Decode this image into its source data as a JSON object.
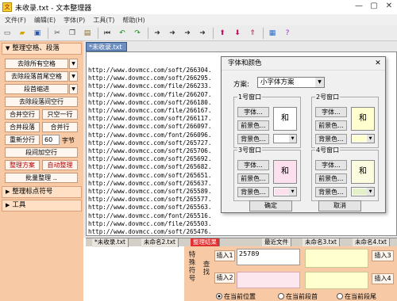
{
  "window": {
    "title": "未收录.txt - 文本整理器",
    "minimize": "—",
    "maximize": "▢",
    "close": "✕"
  },
  "menu": [
    "文件(F)",
    "编辑(E)",
    "字体(P)",
    "工具(T)",
    "帮助(H)"
  ],
  "toolbar_icons": [
    {
      "name": "new-file-icon",
      "glyph": "▭",
      "color": "#555"
    },
    {
      "name": "open-folder-icon",
      "glyph": "▰",
      "color": "#d8a400"
    },
    {
      "name": "save-icon",
      "glyph": "▣",
      "color": "#2a55a8"
    },
    {
      "name": "cut-icon",
      "glyph": "✂",
      "color": "#444"
    },
    {
      "name": "copy-icon",
      "glyph": "❐",
      "color": "#444"
    },
    {
      "name": "paste-icon",
      "glyph": "▤",
      "color": "#8a6a20"
    },
    {
      "name": "first-icon",
      "glyph": "⏮",
      "color": "#333"
    },
    {
      "name": "undo-icon",
      "glyph": "↶",
      "color": "#1a8a1a"
    },
    {
      "name": "redo-icon",
      "glyph": "↷",
      "color": "#1a8a1a"
    },
    {
      "name": "arrow-right-icon",
      "glyph": "➜",
      "color": "#333"
    },
    {
      "name": "arrow-right-2-icon",
      "glyph": "➜",
      "color": "#333"
    },
    {
      "name": "arrow-right-3-icon",
      "glyph": "➜",
      "color": "#333"
    },
    {
      "name": "arrow-right-4-icon",
      "glyph": "➜",
      "color": "#333"
    },
    {
      "name": "move-up-icon",
      "glyph": "⬆",
      "color": "#c01060"
    },
    {
      "name": "move-down-icon",
      "glyph": "⬇",
      "color": "#c01060"
    },
    {
      "name": "move-top-icon",
      "glyph": "⇑",
      "color": "#c01060"
    },
    {
      "name": "color-scheme-icon",
      "glyph": "▦",
      "color": "#2a6acc"
    },
    {
      "name": "help-icon",
      "glyph": "?",
      "color": "#9a2ad0"
    }
  ],
  "left": {
    "section1": "整理空格、段落",
    "remove_all_spaces": "去除所有空格",
    "remove_para_edge_spaces": "去除段落首尾空格",
    "para_indent": "段首缩进",
    "remove_para_gap": "去除段落间空行",
    "merge_empty": "合并空行",
    "single_line": "只空一行",
    "merge_para": "合并段落",
    "merge_lines": "合并行",
    "rewrap": "重新分行",
    "rewrap_value": "60",
    "chars_unit": "字节",
    "add_para_gap": "段间加空行",
    "scheme": "整理方案",
    "auto_tidy": "自动整理",
    "batch": "批量整理 ..",
    "section2": "整理标点符号",
    "section3": "工具"
  },
  "editor": {
    "doc_tab": "*未收录.txt",
    "lines": [
      "http://www.dovmcc.com/soft/266304.",
      "http://www.dovmcc.com/soft/266295.",
      "http://www.dovmcc.com/file/266233.",
      "http://www.dovmcc.com/file/266207.",
      "http://www.dovmcc.com/soft/266180.",
      "http://www.dovmcc.com/file/266167.",
      "http://www.dovmcc.com/soft/266117.",
      "http://www.dovmcc.com/soft/266097.",
      "http://www.dovmcc.com/font/266096.",
      "http://www.dovmcc.com/soft/265727.",
      "http://www.dovmcc.com/soft/265706.",
      "http://www.dovmcc.com/soft/265692.",
      "http://www.dovmcc.com/soft/265682.",
      "http://www.dovmcc.com/soft/265651.",
      "http://www.dovmcc.com/soft/265637.",
      "http://www.dovmcc.com/soft/265589.",
      "http://www.dovmcc.com/soft/265577.",
      "http://www.dovmcc.com/soft/265563.",
      "http://www.dovmcc.com/font/265516.",
      "http://www.dovmcc.com/file/265503.",
      "http://www.dovmcc.com/soft/265476."
    ]
  },
  "bottom_tabs": [
    "*未收录.txt",
    "未命名2.txt",
    "整理结果",
    "最近文件",
    "未命名3.txt",
    "未命名4.txt"
  ],
  "find": {
    "special_symbols": "特殊符号",
    "find_label": "查找",
    "insert1": "插入1",
    "insert2": "插入2",
    "insert3": "插入3",
    "insert4": "插入4",
    "find_value": "25789",
    "radio_current_pos": "在当前位置",
    "radio_para_start": "在当前段首",
    "radio_para_end": "在当前段尾"
  },
  "dialog": {
    "title": "字体和颜色",
    "close": "✕",
    "scheme_label": "方案:",
    "scheme_value": "小字体方案",
    "font_btn": "字体...",
    "fg_btn": "前景色...",
    "bg_btn": "背景色...",
    "preview_char": "和",
    "groups": [
      {
        "label": "1号窗口",
        "preview_bg": "#ffffff",
        "swatch": "#ffffff"
      },
      {
        "label": "2号窗口",
        "preview_bg": "#ffffd0",
        "swatch": "#ffffd0"
      },
      {
        "label": "3号窗口",
        "preview_bg": "#fde0ee",
        "swatch": "#fde0ee"
      },
      {
        "label": "4号窗口",
        "preview_bg": "#fbfbe0",
        "swatch": "#e4f0c8"
      }
    ],
    "ok": "确定",
    "cancel": "取消"
  }
}
